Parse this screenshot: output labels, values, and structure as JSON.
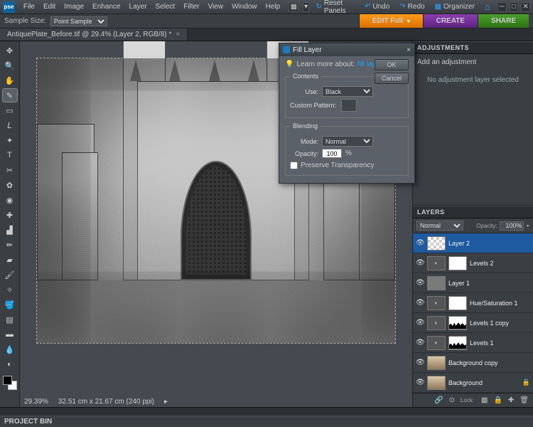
{
  "app": {
    "logo": "pse"
  },
  "menu": [
    "File",
    "Edit",
    "Image",
    "Enhance",
    "Layer",
    "Select",
    "Filter",
    "View",
    "Window",
    "Help"
  ],
  "topRight": {
    "reset": "Reset Panels",
    "undo": "Undo",
    "redo": "Redo",
    "organizer": "Organizer"
  },
  "options": {
    "sampleSizeLabel": "Sample Size:",
    "sampleSize": "Point Sample"
  },
  "modes": {
    "edit": "EDIT Full",
    "create": "CREATE",
    "share": "SHARE"
  },
  "docTab": "AntiquePlate_Before.tif @ 29.4% (Layer 2, RGB/8) *",
  "status": {
    "zoom": "29.39%",
    "docsize": "32.51 cm x 21.67 cm (240 ppi)"
  },
  "projectBin": "PROJECT BIN",
  "adjustments": {
    "title": "ADJUSTMENTS",
    "addLabel": "Add an adjustment",
    "empty": "No adjustment layer selected"
  },
  "layers": {
    "title": "LAYERS",
    "blend": "Normal",
    "opacityLabel": "Opacity:",
    "opacity": "100%",
    "lockLabel": "Lock:",
    "items": [
      {
        "name": "Layer 2",
        "type": "pixel",
        "thumb": "chk",
        "mask": "",
        "selected": true
      },
      {
        "name": "Levels 2",
        "type": "adj",
        "thumb": "adj",
        "mask": "white"
      },
      {
        "name": "Layer 1",
        "type": "pixel",
        "thumb": "grey",
        "mask": ""
      },
      {
        "name": "Hue/Saturation 1",
        "type": "adj",
        "thumb": "adj",
        "mask": "white"
      },
      {
        "name": "Levels 1 copy",
        "type": "adj",
        "thumb": "adj",
        "mask": "skyline"
      },
      {
        "name": "Levels 1",
        "type": "adj",
        "thumb": "adj",
        "mask": "skyline"
      },
      {
        "name": "Background copy",
        "type": "pixel",
        "thumb": "img",
        "mask": ""
      },
      {
        "name": "Background",
        "type": "pixel",
        "thumb": "img",
        "mask": "",
        "locked": true
      }
    ]
  },
  "dialog": {
    "title": "Fill Layer",
    "learnMore": "Learn more about:",
    "learnLink": "fill layer",
    "ok": "OK",
    "cancel": "Cancel",
    "contents": {
      "legend": "Contents",
      "useLabel": "Use:",
      "use": "Black",
      "customPattern": "Custom Pattern:"
    },
    "blending": {
      "legend": "Blending",
      "modeLabel": "Mode:",
      "mode": "Normal",
      "opacityLabel": "Opacity:",
      "opacity": "100",
      "pct": "%",
      "preserve": "Preserve Transparency"
    }
  },
  "tools": [
    {
      "n": "move-tool",
      "g": "✥"
    },
    {
      "n": "zoom-tool",
      "g": "🔍"
    },
    {
      "n": "hand-tool",
      "g": "✋"
    },
    {
      "n": "eyedropper-tool",
      "g": "✎",
      "sel": true
    },
    {
      "n": "marquee-tool",
      "g": "▭"
    },
    {
      "n": "lasso-tool",
      "g": "𝘓"
    },
    {
      "n": "magic-wand-tool",
      "g": "✦"
    },
    {
      "n": "type-tool",
      "g": "T"
    },
    {
      "n": "crop-tool",
      "g": "✂"
    },
    {
      "n": "cookie-cutter-tool",
      "g": "✿"
    },
    {
      "n": "redeye-tool",
      "g": "◉"
    },
    {
      "n": "healing-brush-tool",
      "g": "✚"
    },
    {
      "n": "clone-stamp-tool",
      "g": "▟"
    },
    {
      "n": "pencil-tool",
      "g": "✏"
    },
    {
      "n": "eraser-tool",
      "g": "▰"
    },
    {
      "n": "brush-tool",
      "g": "🖌"
    },
    {
      "n": "smart-brush-tool",
      "g": "✧"
    },
    {
      "n": "paint-bucket-tool",
      "g": "🪣"
    },
    {
      "n": "gradient-tool",
      "g": "▤"
    },
    {
      "n": "shape-tool",
      "g": "▬"
    },
    {
      "n": "blur-tool",
      "g": "💧"
    },
    {
      "n": "sponge-tool",
      "g": "◐"
    }
  ]
}
